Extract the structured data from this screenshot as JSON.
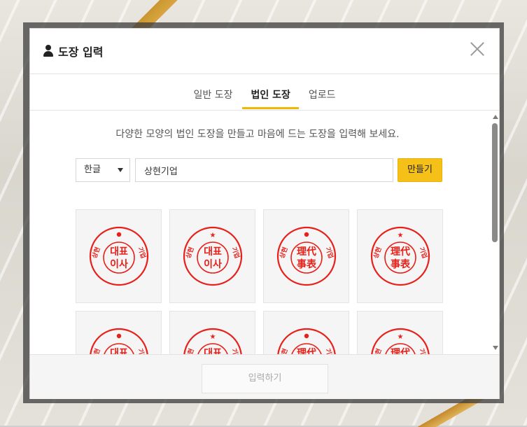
{
  "modal": {
    "title": "도장 입력",
    "close_icon": "close-icon",
    "user_icon": "user-icon"
  },
  "tabs": [
    {
      "label": "일반 도장",
      "active": false
    },
    {
      "label": "법인 도장",
      "active": true
    },
    {
      "label": "업로드",
      "active": false
    }
  ],
  "content": {
    "description": "다양한 모양의 법인 도장을 만들고 마음에 드는 도장을 입력해 보세요.",
    "select": {
      "value": "한글"
    },
    "name_input": {
      "value": "상현기업"
    },
    "make_button": "만들기"
  },
  "stamps": [
    {
      "center_top": "대표",
      "center_bottom": "이사",
      "mark": "dot",
      "ring_left": "상현",
      "ring_right": "기업"
    },
    {
      "center_top": "대표",
      "center_bottom": "이사",
      "mark": "star",
      "ring_left": "상현",
      "ring_right": "기업"
    },
    {
      "center_top": "理代",
      "center_bottom": "事表",
      "mark": "dot",
      "ring_left": "상현",
      "ring_right": "기업"
    },
    {
      "center_top": "理代",
      "center_bottom": "事表",
      "mark": "star",
      "ring_left": "상현",
      "ring_right": "기업"
    },
    {
      "center_top": "대표",
      "center_bottom": "",
      "mark": "dot",
      "ring_left": "상현",
      "ring_right": "기업"
    },
    {
      "center_top": "대표",
      "center_bottom": "",
      "mark": "star",
      "ring_left": "상현",
      "ring_right": "기업"
    },
    {
      "center_top": "理代",
      "center_bottom": "",
      "mark": "dot",
      "ring_left": "상현",
      "ring_right": "기업"
    },
    {
      "center_top": "理代",
      "center_bottom": "",
      "mark": "star",
      "ring_left": "상현",
      "ring_right": "기업"
    }
  ],
  "footer": {
    "submit_button": "입력하기"
  },
  "colors": {
    "accent": "#f5c017",
    "stamp_red": "#e8201a"
  }
}
